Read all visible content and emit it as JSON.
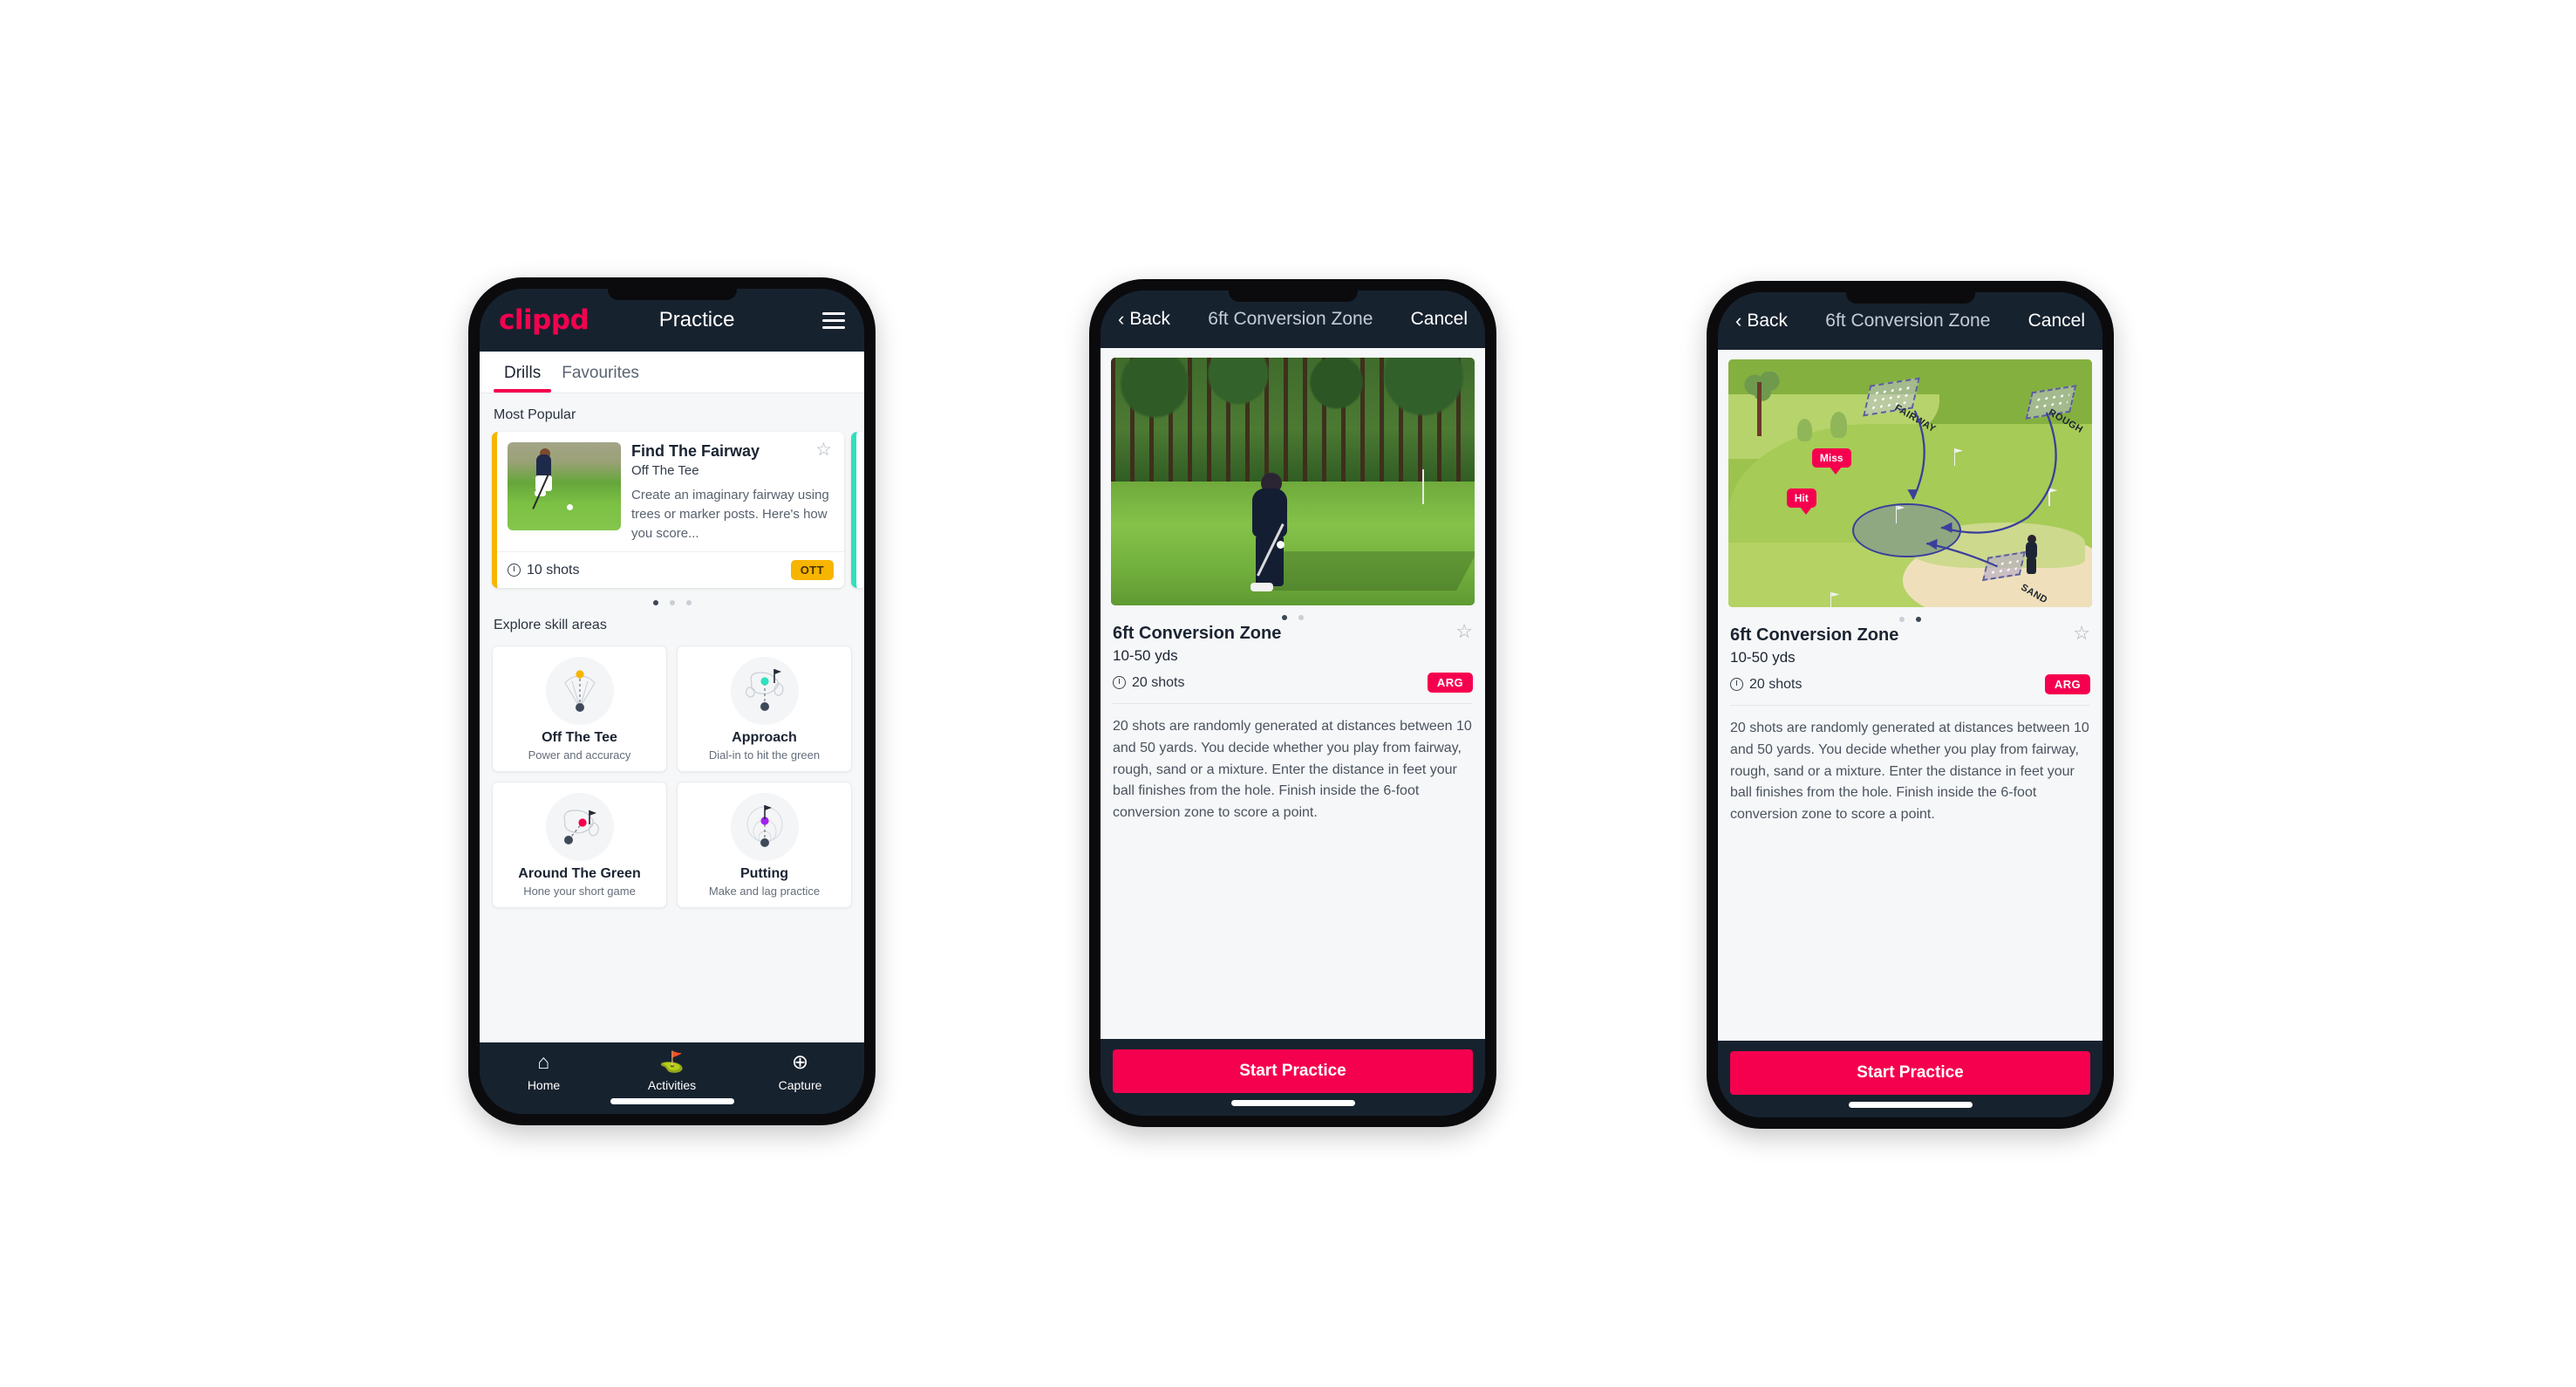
{
  "colors": {
    "brand_pink": "#f5004f",
    "dark_navy": "#17222f",
    "ott_yellow": "#f7b500",
    "arg_pink": "#f5004f",
    "teal_accent": "#2ee0bd",
    "page_bg": "#ffffff"
  },
  "phone1": {
    "logo": "clippd",
    "title": "Practice",
    "menu_icon": "hamburger-menu-icon",
    "tabs": [
      {
        "label": "Drills",
        "active": true
      },
      {
        "label": "Favourites",
        "active": false
      }
    ],
    "section_most_popular": "Most Popular",
    "drill_card": {
      "name": "Find The Fairway",
      "subtitle": "Off The Tee",
      "description": "Create an imaginary fairway using trees or marker posts. Here's how you score...",
      "shots": "10 shots",
      "badge": "OTT",
      "star_icon": "star-outline-icon",
      "clock_icon": "clock-icon",
      "accent_color": "#f7b500"
    },
    "carousel_dots": {
      "count": 3,
      "active_index": 0
    },
    "section_explore": "Explore skill areas",
    "skills": [
      {
        "name": "Off The Tee",
        "desc": "Power and accuracy",
        "icon": "tee-fan-icon",
        "dot_color": "#f7b500"
      },
      {
        "name": "Approach",
        "desc": "Dial-in to hit the green",
        "icon": "approach-green-icon",
        "dot_color": "#2ee0bd"
      },
      {
        "name": "Around The Green",
        "desc": "Hone your short game",
        "icon": "chip-green-icon",
        "dot_color": "#f5004f"
      },
      {
        "name": "Putting",
        "desc": "Make and lag practice",
        "icon": "putting-rings-icon",
        "dot_color": "#a020f0"
      }
    ],
    "bottom_nav": [
      {
        "label": "Home",
        "icon": "home-icon",
        "active": false
      },
      {
        "label": "Activities",
        "icon": "golf-flag-icon",
        "active": true
      },
      {
        "label": "Capture",
        "icon": "plus-circle-icon",
        "active": false
      }
    ]
  },
  "phone2": {
    "back_label": "Back",
    "back_icon": "chevron-left-icon",
    "title": "6ft Conversion Zone",
    "cancel_label": "Cancel",
    "media_type": "video-still-golfer-chipping",
    "carousel_dots": {
      "count": 2,
      "active_index": 0
    },
    "detail_title": "6ft Conversion Zone",
    "detail_yards": "10-50 yds",
    "shots": "20 shots",
    "badge": "ARG",
    "star_icon": "star-outline-icon",
    "clock_icon": "clock-icon",
    "description": "20 shots are randomly generated at distances between 10 and 50 yards. You decide whether you play from fairway, rough, sand or a mixture. Enter the distance in feet your ball finishes from the hole. Finish inside the 6-foot conversion zone to score a point.",
    "cta_label": "Start Practice"
  },
  "phone3": {
    "back_label": "Back",
    "back_icon": "chevron-left-icon",
    "title": "6ft Conversion Zone",
    "cancel_label": "Cancel",
    "media_type": "course-diagram",
    "diagram": {
      "zones": [
        "FAIRWAY",
        "ROUGH",
        "SAND"
      ],
      "callouts": [
        "Miss",
        "Hit"
      ]
    },
    "carousel_dots": {
      "count": 2,
      "active_index": 1
    },
    "detail_title": "6ft Conversion Zone",
    "detail_yards": "10-50 yds",
    "shots": "20 shots",
    "badge": "ARG",
    "star_icon": "star-outline-icon",
    "clock_icon": "clock-icon",
    "description": "20 shots are randomly generated at distances between 10 and 50 yards. You decide whether you play from fairway, rough, sand or a mixture. Enter the distance in feet your ball finishes from the hole. Finish inside the 6-foot conversion zone to score a point.",
    "cta_label": "Start Practice"
  }
}
